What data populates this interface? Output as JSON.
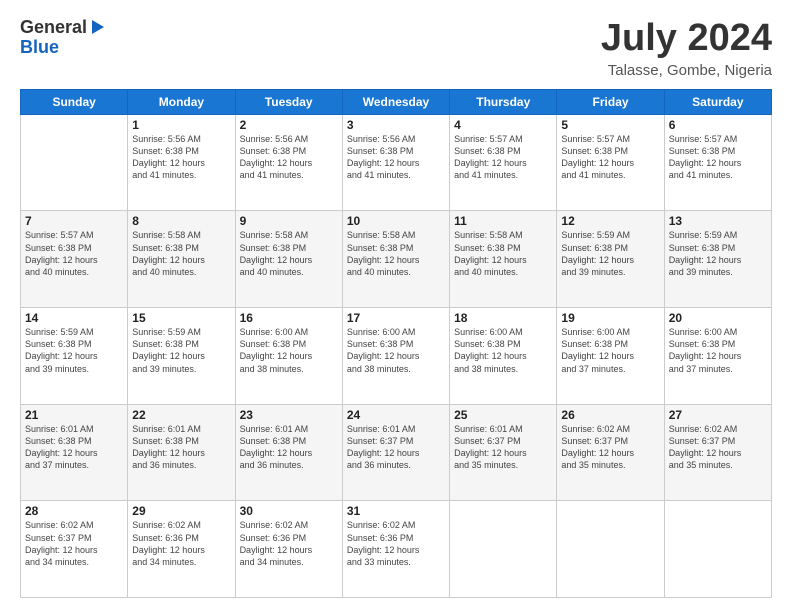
{
  "header": {
    "logo_general": "General",
    "logo_blue": "Blue",
    "month_title": "July 2024",
    "location": "Talasse, Gombe, Nigeria"
  },
  "weekdays": [
    "Sunday",
    "Monday",
    "Tuesday",
    "Wednesday",
    "Thursday",
    "Friday",
    "Saturday"
  ],
  "weeks": [
    [
      {
        "day": "",
        "sunrise": "",
        "sunset": "",
        "daylight": ""
      },
      {
        "day": "1",
        "sunrise": "5:56 AM",
        "sunset": "6:38 PM",
        "daylight": "12 hours and 41 minutes."
      },
      {
        "day": "2",
        "sunrise": "5:56 AM",
        "sunset": "6:38 PM",
        "daylight": "12 hours and 41 minutes."
      },
      {
        "day": "3",
        "sunrise": "5:56 AM",
        "sunset": "6:38 PM",
        "daylight": "12 hours and 41 minutes."
      },
      {
        "day": "4",
        "sunrise": "5:57 AM",
        "sunset": "6:38 PM",
        "daylight": "12 hours and 41 minutes."
      },
      {
        "day": "5",
        "sunrise": "5:57 AM",
        "sunset": "6:38 PM",
        "daylight": "12 hours and 41 minutes."
      },
      {
        "day": "6",
        "sunrise": "5:57 AM",
        "sunset": "6:38 PM",
        "daylight": "12 hours and 41 minutes."
      }
    ],
    [
      {
        "day": "7",
        "sunrise": "5:57 AM",
        "sunset": "6:38 PM",
        "daylight": "12 hours and 40 minutes."
      },
      {
        "day": "8",
        "sunrise": "5:58 AM",
        "sunset": "6:38 PM",
        "daylight": "12 hours and 40 minutes."
      },
      {
        "day": "9",
        "sunrise": "5:58 AM",
        "sunset": "6:38 PM",
        "daylight": "12 hours and 40 minutes."
      },
      {
        "day": "10",
        "sunrise": "5:58 AM",
        "sunset": "6:38 PM",
        "daylight": "12 hours and 40 minutes."
      },
      {
        "day": "11",
        "sunrise": "5:58 AM",
        "sunset": "6:38 PM",
        "daylight": "12 hours and 40 minutes."
      },
      {
        "day": "12",
        "sunrise": "5:59 AM",
        "sunset": "6:38 PM",
        "daylight": "12 hours and 39 minutes."
      },
      {
        "day": "13",
        "sunrise": "5:59 AM",
        "sunset": "6:38 PM",
        "daylight": "12 hours and 39 minutes."
      }
    ],
    [
      {
        "day": "14",
        "sunrise": "5:59 AM",
        "sunset": "6:38 PM",
        "daylight": "12 hours and 39 minutes."
      },
      {
        "day": "15",
        "sunrise": "5:59 AM",
        "sunset": "6:38 PM",
        "daylight": "12 hours and 39 minutes."
      },
      {
        "day": "16",
        "sunrise": "6:00 AM",
        "sunset": "6:38 PM",
        "daylight": "12 hours and 38 minutes."
      },
      {
        "day": "17",
        "sunrise": "6:00 AM",
        "sunset": "6:38 PM",
        "daylight": "12 hours and 38 minutes."
      },
      {
        "day": "18",
        "sunrise": "6:00 AM",
        "sunset": "6:38 PM",
        "daylight": "12 hours and 38 minutes."
      },
      {
        "day": "19",
        "sunrise": "6:00 AM",
        "sunset": "6:38 PM",
        "daylight": "12 hours and 37 minutes."
      },
      {
        "day": "20",
        "sunrise": "6:00 AM",
        "sunset": "6:38 PM",
        "daylight": "12 hours and 37 minutes."
      }
    ],
    [
      {
        "day": "21",
        "sunrise": "6:01 AM",
        "sunset": "6:38 PM",
        "daylight": "12 hours and 37 minutes."
      },
      {
        "day": "22",
        "sunrise": "6:01 AM",
        "sunset": "6:38 PM",
        "daylight": "12 hours and 36 minutes."
      },
      {
        "day": "23",
        "sunrise": "6:01 AM",
        "sunset": "6:38 PM",
        "daylight": "12 hours and 36 minutes."
      },
      {
        "day": "24",
        "sunrise": "6:01 AM",
        "sunset": "6:37 PM",
        "daylight": "12 hours and 36 minutes."
      },
      {
        "day": "25",
        "sunrise": "6:01 AM",
        "sunset": "6:37 PM",
        "daylight": "12 hours and 35 minutes."
      },
      {
        "day": "26",
        "sunrise": "6:02 AM",
        "sunset": "6:37 PM",
        "daylight": "12 hours and 35 minutes."
      },
      {
        "day": "27",
        "sunrise": "6:02 AM",
        "sunset": "6:37 PM",
        "daylight": "12 hours and 35 minutes."
      }
    ],
    [
      {
        "day": "28",
        "sunrise": "6:02 AM",
        "sunset": "6:37 PM",
        "daylight": "12 hours and 34 minutes."
      },
      {
        "day": "29",
        "sunrise": "6:02 AM",
        "sunset": "6:36 PM",
        "daylight": "12 hours and 34 minutes."
      },
      {
        "day": "30",
        "sunrise": "6:02 AM",
        "sunset": "6:36 PM",
        "daylight": "12 hours and 34 minutes."
      },
      {
        "day": "31",
        "sunrise": "6:02 AM",
        "sunset": "6:36 PM",
        "daylight": "12 hours and 33 minutes."
      },
      {
        "day": "",
        "sunrise": "",
        "sunset": "",
        "daylight": ""
      },
      {
        "day": "",
        "sunrise": "",
        "sunset": "",
        "daylight": ""
      },
      {
        "day": "",
        "sunrise": "",
        "sunset": "",
        "daylight": ""
      }
    ]
  ],
  "labels": {
    "sunrise_prefix": "Sunrise: ",
    "sunset_prefix": "Sunset: ",
    "daylight_prefix": "Daylight: "
  }
}
